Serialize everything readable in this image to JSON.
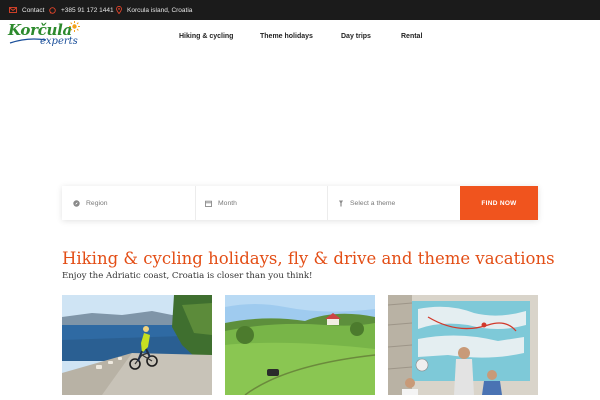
{
  "topbar": {
    "contact_label": "Contact",
    "phone": "+385 91 172 1441",
    "location": "Korcula island, Croatia",
    "icon_color": "#e0442a",
    "icons": [
      "envelope-icon",
      "whatsapp-icon",
      "map-pin-icon"
    ]
  },
  "brand": {
    "logo_word": "Korčula",
    "logo_sub": "experts",
    "logo_colors": {
      "green": "#2c8a2c",
      "blue": "#1a4f9a",
      "sun": "#f4a21a"
    }
  },
  "nav": {
    "items": [
      {
        "label": "Hiking & cycling"
      },
      {
        "label": "Theme holidays"
      },
      {
        "label": "Day trips"
      },
      {
        "label": "Rental"
      }
    ]
  },
  "search": {
    "region_placeholder": "Region",
    "month_placeholder": "Month",
    "theme_placeholder": "Select a theme",
    "button_label": "FIND NOW",
    "icons": [
      "compass-icon",
      "calendar-icon",
      "filter-icon"
    ]
  },
  "intro": {
    "headline": "Hiking & cycling holidays, fly & drive and theme vacations",
    "subheadline": "Enjoy the Adriatic coast, Croatia is closer than you think!"
  },
  "colors": {
    "accent": "#f0541e",
    "headline": "#e34e16",
    "topbar_bg": "#1b1b1b"
  },
  "cards": [
    {
      "image": "cyclist on coastal road"
    },
    {
      "image": "green hills and countryside"
    },
    {
      "image": "children viewing map wall"
    }
  ]
}
